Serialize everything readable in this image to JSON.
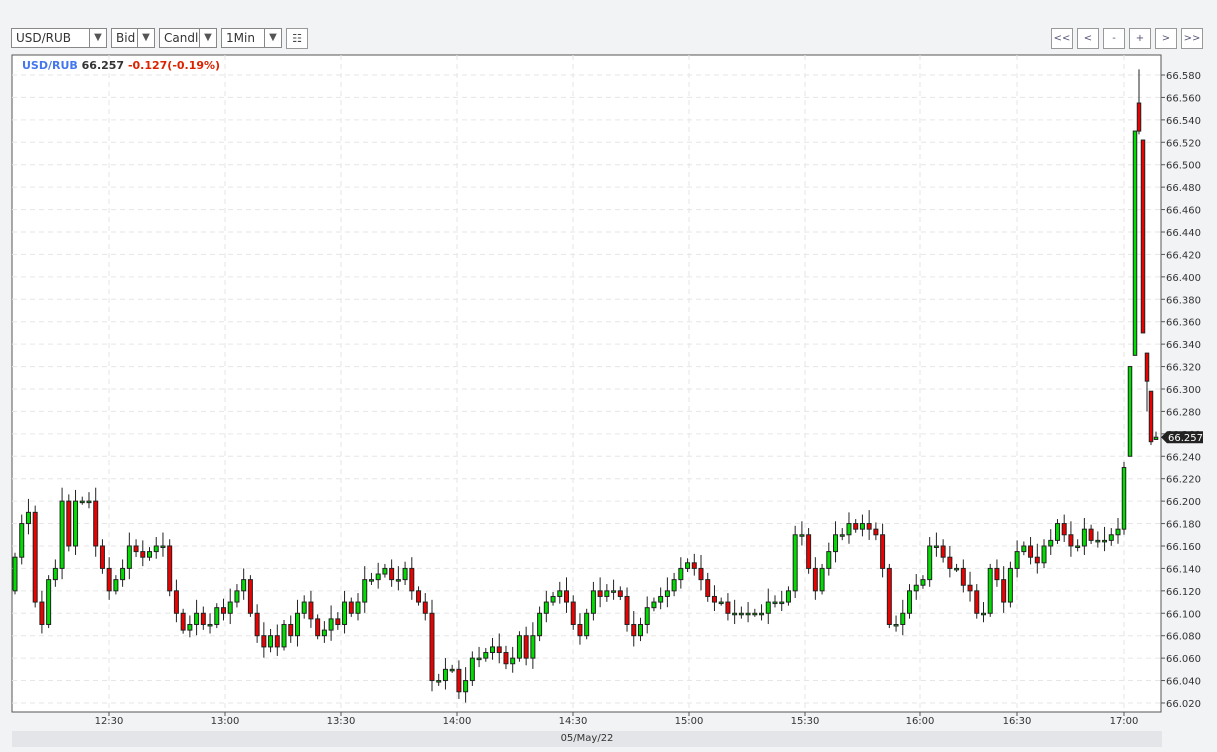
{
  "toolbar": {
    "symbol": "USD/RUB",
    "price_type": "Bid",
    "chart_type": "Candle",
    "interval": "1Min",
    "nav_buttons": [
      "<<",
      "<",
      "-",
      "+",
      ">",
      ">>"
    ],
    "dropdown_icon": "triangle-down-icon",
    "table_icon": "list-icon"
  },
  "legend": {
    "symbol": "USD/RUB",
    "last": "66.257",
    "change": "-0.127(-0.19%)"
  },
  "date_label": "05/May/22",
  "colors": {
    "up": "#00dd00",
    "down": "#ee0000",
    "symbol": "#4477ee",
    "change": "#dd2200"
  },
  "chart_data": {
    "type": "candlestick",
    "title": "USD/RUB Bid 1Min",
    "ylim": [
      66.01,
      66.59
    ],
    "yticks": [
      "66.020",
      "66.040",
      "66.060",
      "66.080",
      "66.100",
      "66.120",
      "66.140",
      "66.160",
      "66.180",
      "66.200",
      "66.220",
      "66.240",
      "66.260",
      "66.280",
      "66.300",
      "66.320",
      "66.340",
      "66.360",
      "66.380",
      "66.400",
      "66.420",
      "66.440",
      "66.460",
      "66.480",
      "66.500",
      "66.520",
      "66.540",
      "66.560",
      "66.580"
    ],
    "xticks": [
      "12:30",
      "13:00",
      "13:30",
      "14:00",
      "14:30",
      "15:00",
      "15:30",
      "16:00",
      "16:30",
      "17:00"
    ],
    "current_price": "66.257",
    "first_open": 66.12,
    "closes": [
      66.15,
      66.18,
      66.19,
      66.11,
      66.09,
      66.13,
      66.14,
      66.2,
      66.16,
      66.2,
      66.2,
      66.2,
      66.16,
      66.14,
      66.12,
      66.13,
      66.14,
      66.16,
      66.155,
      66.15,
      66.155,
      66.16,
      66.16,
      66.12,
      66.1,
      66.085,
      66.09,
      66.1,
      66.09,
      66.09,
      66.105,
      66.1,
      66.11,
      66.12,
      66.13,
      66.1,
      66.08,
      66.07,
      66.08,
      66.07,
      66.09,
      66.08,
      66.1,
      66.11,
      66.095,
      66.08,
      66.085,
      66.095,
      66.09,
      66.11,
      66.1,
      66.11,
      66.13,
      66.13,
      66.135,
      66.14,
      66.13,
      66.13,
      66.14,
      66.12,
      66.11,
      66.1,
      66.04,
      66.04,
      66.05,
      66.05,
      66.03,
      66.04,
      66.06,
      66.06,
      66.065,
      66.07,
      66.065,
      66.055,
      66.06,
      66.08,
      66.06,
      66.08,
      66.1,
      66.11,
      66.115,
      66.12,
      66.11,
      66.09,
      66.08,
      66.1,
      66.12,
      66.115,
      66.12,
      66.12,
      66.115,
      66.09,
      66.08,
      66.09,
      66.105,
      66.11,
      66.115,
      66.12,
      66.13,
      66.14,
      66.145,
      66.14,
      66.13,
      66.115,
      66.11,
      66.11,
      66.1,
      66.1,
      66.1,
      66.1,
      66.1,
      66.1,
      66.11,
      66.11,
      66.11,
      66.12,
      66.17,
      66.17,
      66.14,
      66.12,
      66.14,
      66.155,
      66.17,
      66.17,
      66.18,
      66.175,
      66.18,
      66.175,
      66.17,
      66.14,
      66.09,
      66.09,
      66.1,
      66.12,
      66.125,
      66.13,
      66.16,
      66.16,
      66.15,
      66.14,
      66.14,
      66.125,
      66.12,
      66.1,
      66.1,
      66.14,
      66.13,
      66.11,
      66.14,
      66.155,
      66.16,
      66.15,
      66.145,
      66.16,
      66.165,
      66.18,
      66.17,
      66.16,
      66.16,
      66.175,
      66.165,
      66.165,
      66.165,
      66.17,
      66.175
    ],
    "tail_ohlc": [
      [
        66.175,
        66.235,
        66.17,
        66.23
      ],
      [
        66.24,
        66.32,
        66.24,
        66.32
      ],
      [
        66.33,
        66.53,
        66.33,
        66.53
      ],
      [
        66.555,
        66.585,
        66.527,
        66.53
      ],
      [
        66.522,
        66.522,
        66.35,
        66.35
      ],
      [
        66.332,
        66.332,
        66.28,
        66.307
      ],
      [
        66.298,
        66.298,
        66.25,
        66.253
      ],
      [
        66.255,
        66.262,
        66.255,
        66.257
      ]
    ],
    "grid": true
  }
}
